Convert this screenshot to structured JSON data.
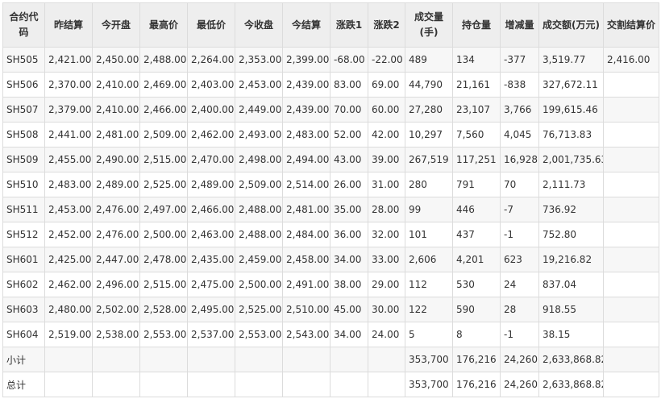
{
  "headers": [
    "合约代码",
    "昨结算",
    "今开盘",
    "最高价",
    "最低价",
    "今收盘",
    "今结算",
    "涨跌1",
    "涨跌2",
    "成交量(手)",
    "持仓量",
    "增减量",
    "成交额(万元)",
    "交割结算价"
  ],
  "rows": [
    [
      "SH505",
      "2,421.00",
      "2,450.00",
      "2,488.00",
      "2,264.00",
      "2,353.00",
      "2,399.00",
      "-68.00",
      "-22.00",
      "489",
      "134",
      "-377",
      "3,519.77",
      "2,416.00"
    ],
    [
      "SH506",
      "2,370.00",
      "2,410.00",
      "2,469.00",
      "2,403.00",
      "2,453.00",
      "2,439.00",
      "83.00",
      "69.00",
      "44,790",
      "21,161",
      "-838",
      "327,672.11",
      ""
    ],
    [
      "SH507",
      "2,379.00",
      "2,410.00",
      "2,466.00",
      "2,400.00",
      "2,449.00",
      "2,439.00",
      "70.00",
      "60.00",
      "27,280",
      "23,107",
      "3,766",
      "199,615.46",
      ""
    ],
    [
      "SH508",
      "2,441.00",
      "2,481.00",
      "2,509.00",
      "2,462.00",
      "2,493.00",
      "2,483.00",
      "52.00",
      "42.00",
      "10,297",
      "7,560",
      "4,045",
      "76,713.83",
      ""
    ],
    [
      "SH509",
      "2,455.00",
      "2,490.00",
      "2,515.00",
      "2,470.00",
      "2,498.00",
      "2,494.00",
      "43.00",
      "39.00",
      "267,519",
      "117,251",
      "16,928",
      "2,001,735.63",
      ""
    ],
    [
      "SH510",
      "2,483.00",
      "2,489.00",
      "2,525.00",
      "2,489.00",
      "2,509.00",
      "2,514.00",
      "26.00",
      "31.00",
      "280",
      "791",
      "70",
      "2,111.73",
      ""
    ],
    [
      "SH511",
      "2,453.00",
      "2,476.00",
      "2,497.00",
      "2,466.00",
      "2,488.00",
      "2,481.00",
      "35.00",
      "28.00",
      "99",
      "446",
      "-7",
      "736.92",
      ""
    ],
    [
      "SH512",
      "2,452.00",
      "2,476.00",
      "2,500.00",
      "2,463.00",
      "2,488.00",
      "2,484.00",
      "36.00",
      "32.00",
      "101",
      "437",
      "-1",
      "752.80",
      ""
    ],
    [
      "SH601",
      "2,425.00",
      "2,447.00",
      "2,478.00",
      "2,435.00",
      "2,459.00",
      "2,458.00",
      "34.00",
      "33.00",
      "2,606",
      "4,201",
      "623",
      "19,216.82",
      ""
    ],
    [
      "SH602",
      "2,462.00",
      "2,496.00",
      "2,515.00",
      "2,475.00",
      "2,500.00",
      "2,491.00",
      "38.00",
      "29.00",
      "112",
      "530",
      "24",
      "837.04",
      ""
    ],
    [
      "SH603",
      "2,480.00",
      "2,502.00",
      "2,528.00",
      "2,495.00",
      "2,525.00",
      "2,510.00",
      "45.00",
      "30.00",
      "122",
      "590",
      "28",
      "918.55",
      ""
    ],
    [
      "SH604",
      "2,519.00",
      "2,538.00",
      "2,553.00",
      "2,537.00",
      "2,553.00",
      "2,543.00",
      "34.00",
      "24.00",
      "5",
      "8",
      "-1",
      "38.15",
      ""
    ]
  ],
  "subtotal": [
    "小计",
    "",
    "",
    "",
    "",
    "",
    "",
    "",
    "",
    "353,700",
    "176,216",
    "24,260",
    "2,633,868.82",
    ""
  ],
  "total": [
    "总计",
    "",
    "",
    "",
    "",
    "",
    "",
    "",
    "",
    "353,700",
    "176,216",
    "24,260",
    "2,633,868.82",
    ""
  ]
}
